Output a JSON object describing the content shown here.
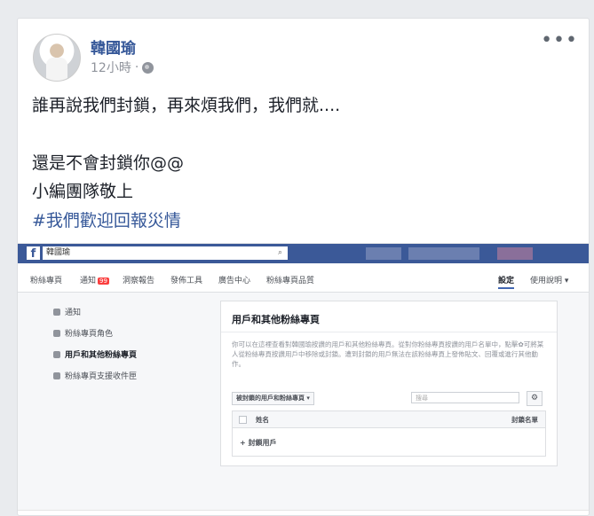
{
  "post": {
    "author": "韓國瑜",
    "time": "12小時",
    "dot": "·",
    "more": "•••",
    "lines": [
      "誰再說我們封鎖，再來煩我們，我們就....",
      "還是不會封鎖你@@",
      "小編團隊敬上"
    ],
    "hashtag": "#我們歡迎回報災情"
  },
  "screenshot": {
    "logo": "f",
    "search_value": "韓國瑜",
    "nav": {
      "items": [
        "粉絲專頁",
        "通知",
        "洞察報告",
        "發佈工具",
        "廣告中心",
        "粉絲專頁品質"
      ],
      "notification_badge": "99",
      "settings": "設定",
      "help": "使用說明 ▾"
    },
    "side_menu": [
      "通知",
      "粉絲專頁角色",
      "用戶和其他粉絲專頁",
      "粉絲專頁支援收件匣"
    ],
    "panel": {
      "title": "用戶和其他粉絲專頁",
      "description": "你可以在這裡查看對韓國瑜按讚的用戶和其他粉絲專頁。從對你粉絲專頁按讚的用戶名單中，點擊✿可將某人從粉絲專頁按讚用戶中移除或封鎖。遭到封鎖的用戶無法在該粉絲專頁上發佈貼文、回覆或進行其他動作。",
      "dropdown": "被封鎖的用戶和粉絲專頁 ▾",
      "search_placeholder": "搜尋",
      "col_name": "姓名",
      "col_blocked": "封鎖名單",
      "add_link": "+ 封鎖用戶"
    }
  }
}
